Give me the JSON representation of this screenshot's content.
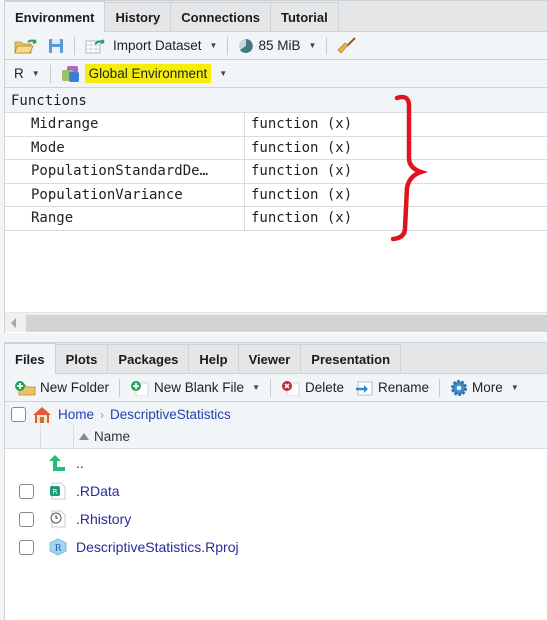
{
  "env_pane": {
    "tabs": [
      {
        "label": "Environment",
        "active": true
      },
      {
        "label": "History",
        "active": false
      },
      {
        "label": "Connections",
        "active": false
      },
      {
        "label": "Tutorial",
        "active": false
      }
    ],
    "toolbar": {
      "import_dataset": "Import Dataset",
      "memory": "85 MiB"
    },
    "lang_selector": "R",
    "scope_selector": "Global Environment",
    "highlight_color": "#f5ee0a",
    "section": "Functions",
    "variables": [
      {
        "name": "Midrange",
        "value": "function (x)"
      },
      {
        "name": "Mode",
        "value": "function (x)"
      },
      {
        "name": "PopulationStandardDe…",
        "value": "function (x)"
      },
      {
        "name": "PopulationVariance",
        "value": "function (x)"
      },
      {
        "name": "Range",
        "value": "function (x)"
      }
    ],
    "annotation_color": "#e0141e"
  },
  "files_pane": {
    "tabs": [
      {
        "label": "Files",
        "active": true
      },
      {
        "label": "Plots",
        "active": false
      },
      {
        "label": "Packages",
        "active": false
      },
      {
        "label": "Help",
        "active": false
      },
      {
        "label": "Viewer",
        "active": false
      },
      {
        "label": "Presentation",
        "active": false
      }
    ],
    "toolbar": {
      "new_folder": "New Folder",
      "new_blank_file": "New Blank File",
      "delete": "Delete",
      "rename": "Rename",
      "more": "More"
    },
    "breadcrumb": [
      "Home",
      "DescriptiveStatistics"
    ],
    "column_header": "Name",
    "parent_dir": "..",
    "files": [
      {
        "name": ".RData",
        "icon": "rdata-file-icon"
      },
      {
        "name": ".Rhistory",
        "icon": "rhistory-file-icon"
      },
      {
        "name": "DescriptiveStatistics.Rproj",
        "icon": "rproj-file-icon"
      }
    ]
  }
}
